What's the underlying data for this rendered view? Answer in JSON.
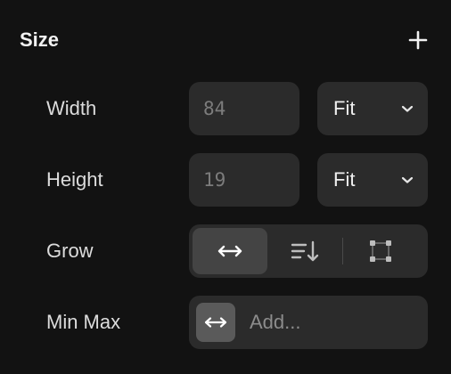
{
  "section": {
    "title": "Size",
    "add_icon": "plus-icon"
  },
  "width": {
    "label": "Width",
    "value": "84",
    "mode": "Fit",
    "mode_icon": "chevron-down-icon"
  },
  "height": {
    "label": "Height",
    "value": "19",
    "mode": "Fit",
    "mode_icon": "chevron-down-icon"
  },
  "grow": {
    "label": "Grow",
    "options": [
      {
        "icon": "horizontal-arrows-icon",
        "active": true
      },
      {
        "icon": "vertical-sort-icon",
        "active": false
      },
      {
        "icon": "fill-frame-icon",
        "active": false
      }
    ]
  },
  "min_max": {
    "label": "Min Max",
    "icon": "horizontal-arrows-icon",
    "placeholder": "Add..."
  },
  "colors": {
    "background": "#121212",
    "field": "#2b2b2b",
    "active_segment": "#444444",
    "text": "#e6e6e6",
    "muted_text": "#7c7c7c"
  }
}
